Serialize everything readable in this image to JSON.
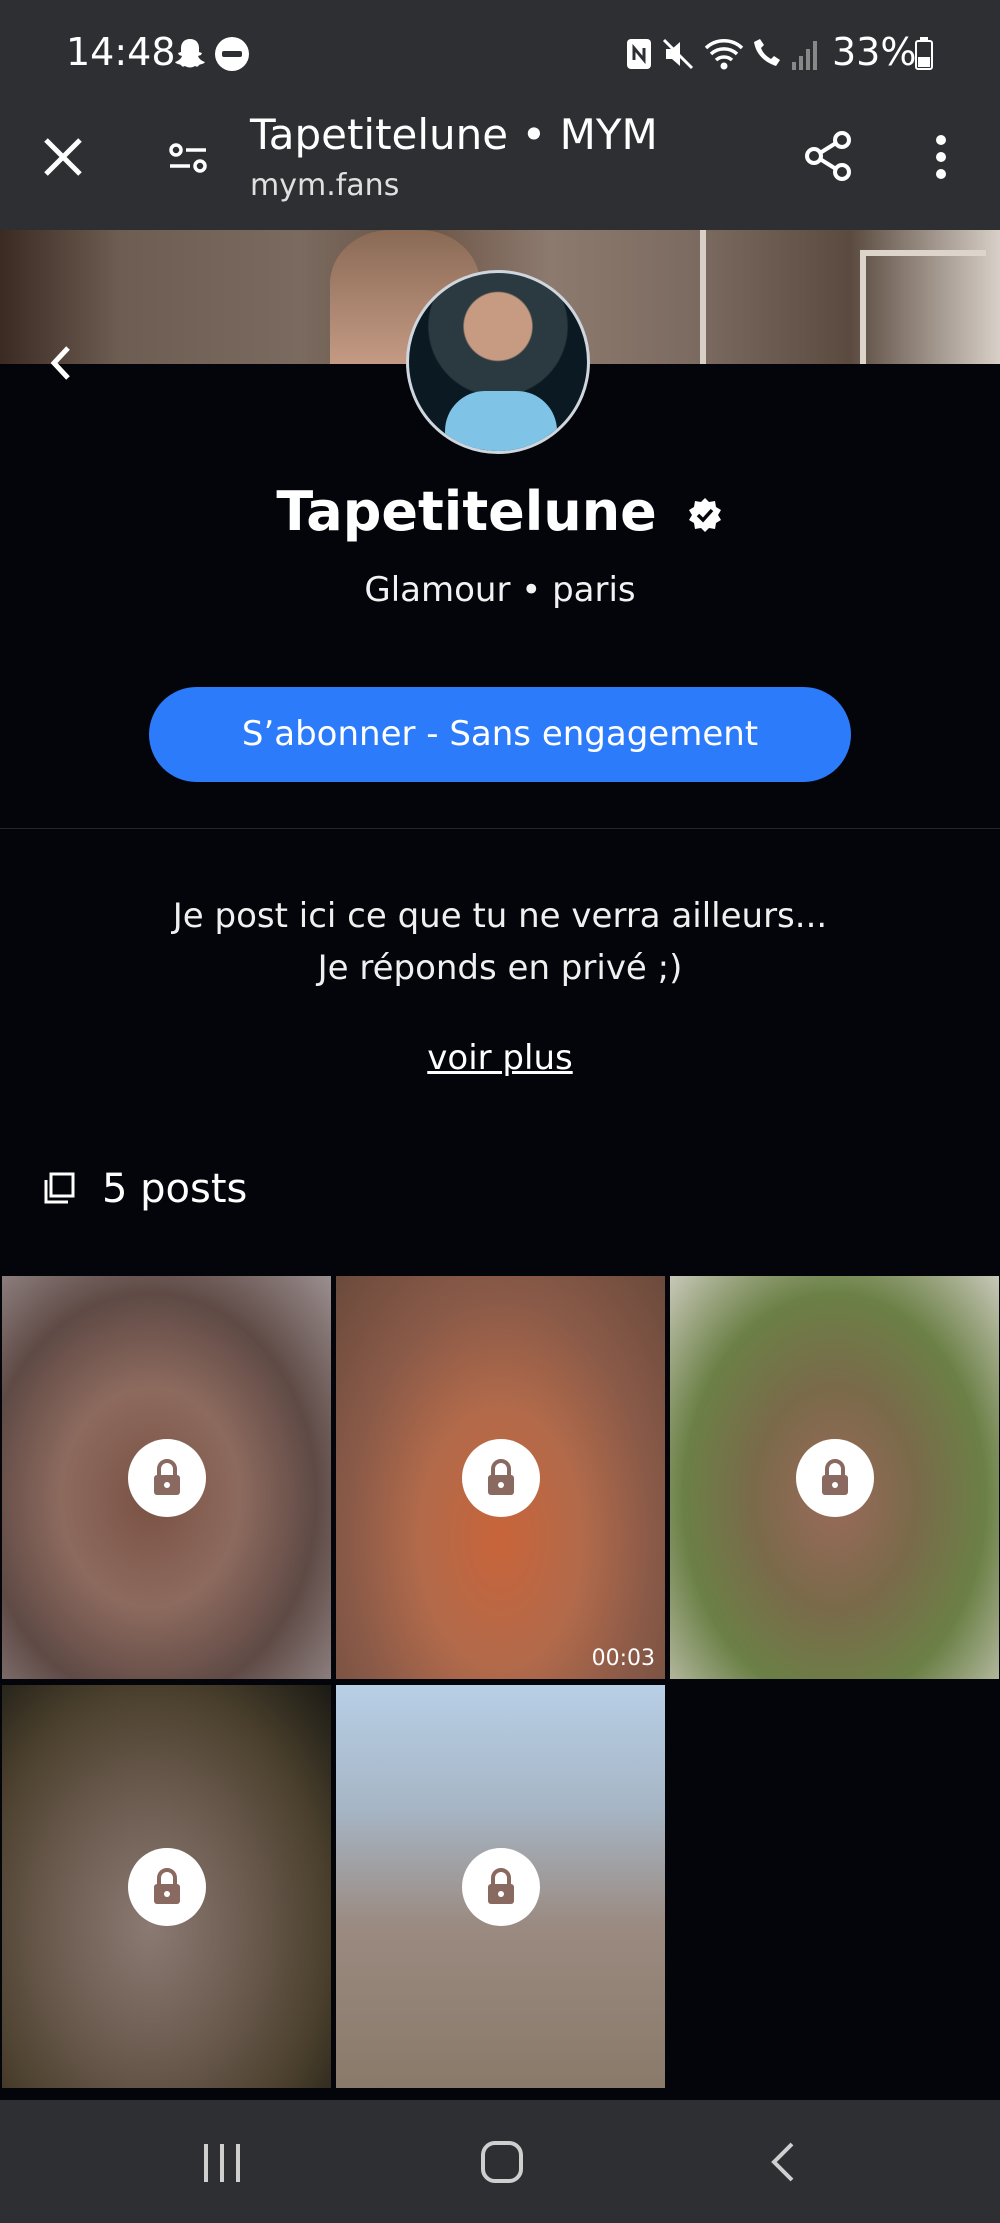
{
  "status_bar": {
    "time": "14:48",
    "battery": "33%",
    "icons": [
      "snapchat-icon",
      "do-not-disturb-icon",
      "nfc-icon",
      "mute-icon",
      "wifi-icon",
      "wifi-call-icon",
      "signal-icon",
      "battery-icon"
    ]
  },
  "custom_tab": {
    "title": "Tapetitelune • MYM",
    "url": "mym.fans",
    "icons": [
      "close-icon",
      "site-settings-icon",
      "share-icon",
      "more-icon"
    ]
  },
  "profile": {
    "name": "Tapetitelune",
    "subtitle": "Glamour • paris",
    "subscribe_label": "S’abonner - Sans engagement",
    "bio_line1": "Je post ici ce que tu ne verra ailleurs...",
    "bio_line2": "Je réponds en privé ;)",
    "more_label": "voir plus",
    "posts_label": "5 posts"
  },
  "posts": [
    {
      "locked": true
    },
    {
      "locked": true,
      "duration": "00:03"
    },
    {
      "locked": true
    },
    {
      "locked": true
    },
    {
      "locked": true
    }
  ],
  "colors": {
    "accent": "#2b7bfb",
    "background": "#04050a",
    "chrome": "#2e2f33",
    "lock_glyph": "#8a6a60"
  }
}
